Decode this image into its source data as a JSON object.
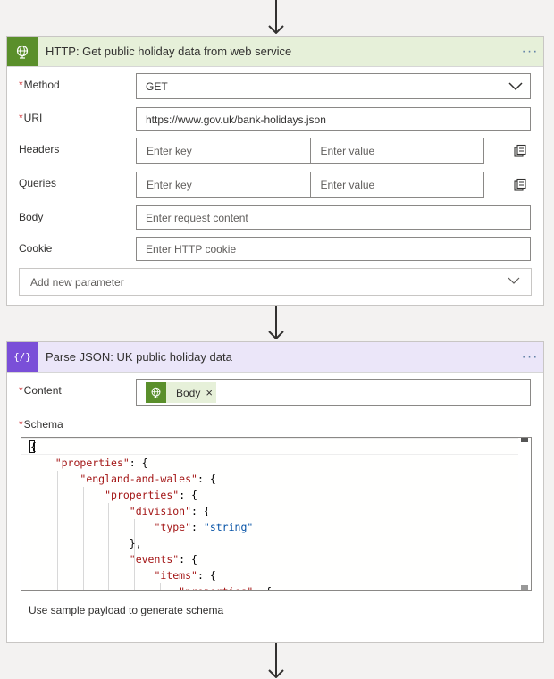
{
  "http_action": {
    "title": "HTTP: Get public holiday data from web service",
    "icon": "globe-icon",
    "more": "···",
    "method": {
      "label": "Method",
      "value": "GET"
    },
    "uri": {
      "label": "URI",
      "value": "https://www.gov.uk/bank-holidays.json"
    },
    "headers": {
      "label": "Headers",
      "key_placeholder": "Enter key",
      "value_placeholder": "Enter value"
    },
    "queries": {
      "label": "Queries",
      "key_placeholder": "Enter key",
      "value_placeholder": "Enter value"
    },
    "body": {
      "label": "Body",
      "placeholder": "Enter request content"
    },
    "cookie": {
      "label": "Cookie",
      "placeholder": "Enter HTTP cookie"
    },
    "add_parameter": "Add new parameter",
    "required_mark": "*",
    "accent": "#5a8f2b"
  },
  "parse_action": {
    "title": "Parse JSON: UK public holiday data",
    "icon": "curly-braces-icon",
    "more": "···",
    "content": {
      "label": "Content",
      "token_label": "Body",
      "token_remove": "×"
    },
    "schema": {
      "label": "Schema",
      "lines": [
        "{",
        "    \"properties\": {",
        "        \"england-and-wales\": {",
        "            \"properties\": {",
        "                \"division\": {",
        "                    \"type\": \"string\"",
        "                },",
        "                \"events\": {",
        "                    \"items\": {",
        "                        \"properties\": {"
      ]
    },
    "sample_link": "Use sample payload to generate schema",
    "required_mark": "*",
    "accent": "#7a4fd8"
  }
}
